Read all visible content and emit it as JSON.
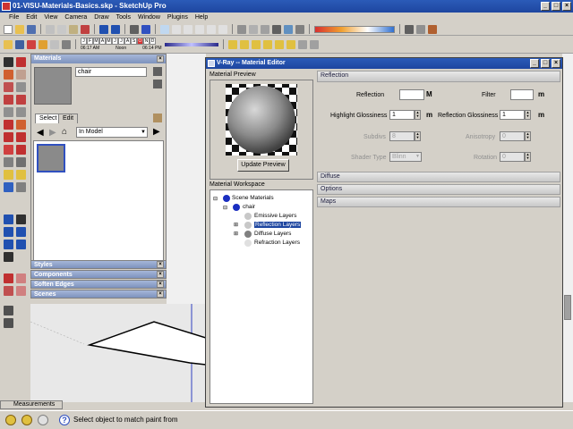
{
  "window": {
    "title": "01-VISU-Materials-Basics.skp - SketchUp Pro"
  },
  "menu": [
    "File",
    "Edit",
    "View",
    "Camera",
    "Draw",
    "Tools",
    "Window",
    "Plugins",
    "Help"
  ],
  "shadow_toolbar": {
    "months": [
      "J",
      "F",
      "M",
      "A",
      "M",
      "J",
      "J",
      "A",
      "S",
      "O",
      "N",
      "D"
    ],
    "start_time": "06:17 AM",
    "noon": "Noon",
    "end_time": "06:14 PM"
  },
  "materials_panel": {
    "title": "Materials",
    "material_name": "chair",
    "tabs": [
      "Select",
      "Edit"
    ],
    "collection": "In Model"
  },
  "collapsed_panels": [
    "Styles",
    "Components",
    "Soften Edges",
    "Scenes"
  ],
  "vray": {
    "title": "V-Ray -- Material Editor",
    "preview_title": "Material Preview",
    "update_button": "Update Preview",
    "workspace_title": "Material Workspace",
    "tree": {
      "root": "Scene Materials",
      "material": "chair",
      "layers": [
        "Emissive Layers",
        "Reflection Layers",
        "Diffuse Layers",
        "Refraction Layers"
      ],
      "selected_layer": "Reflection Layers"
    },
    "reflection": {
      "header": "Reflection",
      "reflection_label": "Reflection",
      "reflection_map": "M",
      "filter_label": "Filter",
      "filter_map": "m",
      "hilight_label": "Highlight Glossiness",
      "hilight_value": "1",
      "hilight_map": "m",
      "refl_gloss_label": "Reflection Glossiness",
      "refl_gloss_value": "1",
      "refl_gloss_map": "m",
      "subdivs_label": "Subdivs",
      "subdivs_value": "8",
      "aniso_label": "Anisotropy",
      "aniso_value": "0",
      "shader_label": "Shader Type",
      "shader_value": "Blinn",
      "rotation_label": "Rotation",
      "rotation_value": "0"
    },
    "sections": [
      "Diffuse",
      "Options",
      "Maps"
    ]
  },
  "measurements_label": "Measurements",
  "status_text": "Select object to match paint from",
  "colors": {
    "title_blue": "#1e46a0",
    "panel_gray": "#d4d0c8",
    "accent_red": "#d83030"
  }
}
